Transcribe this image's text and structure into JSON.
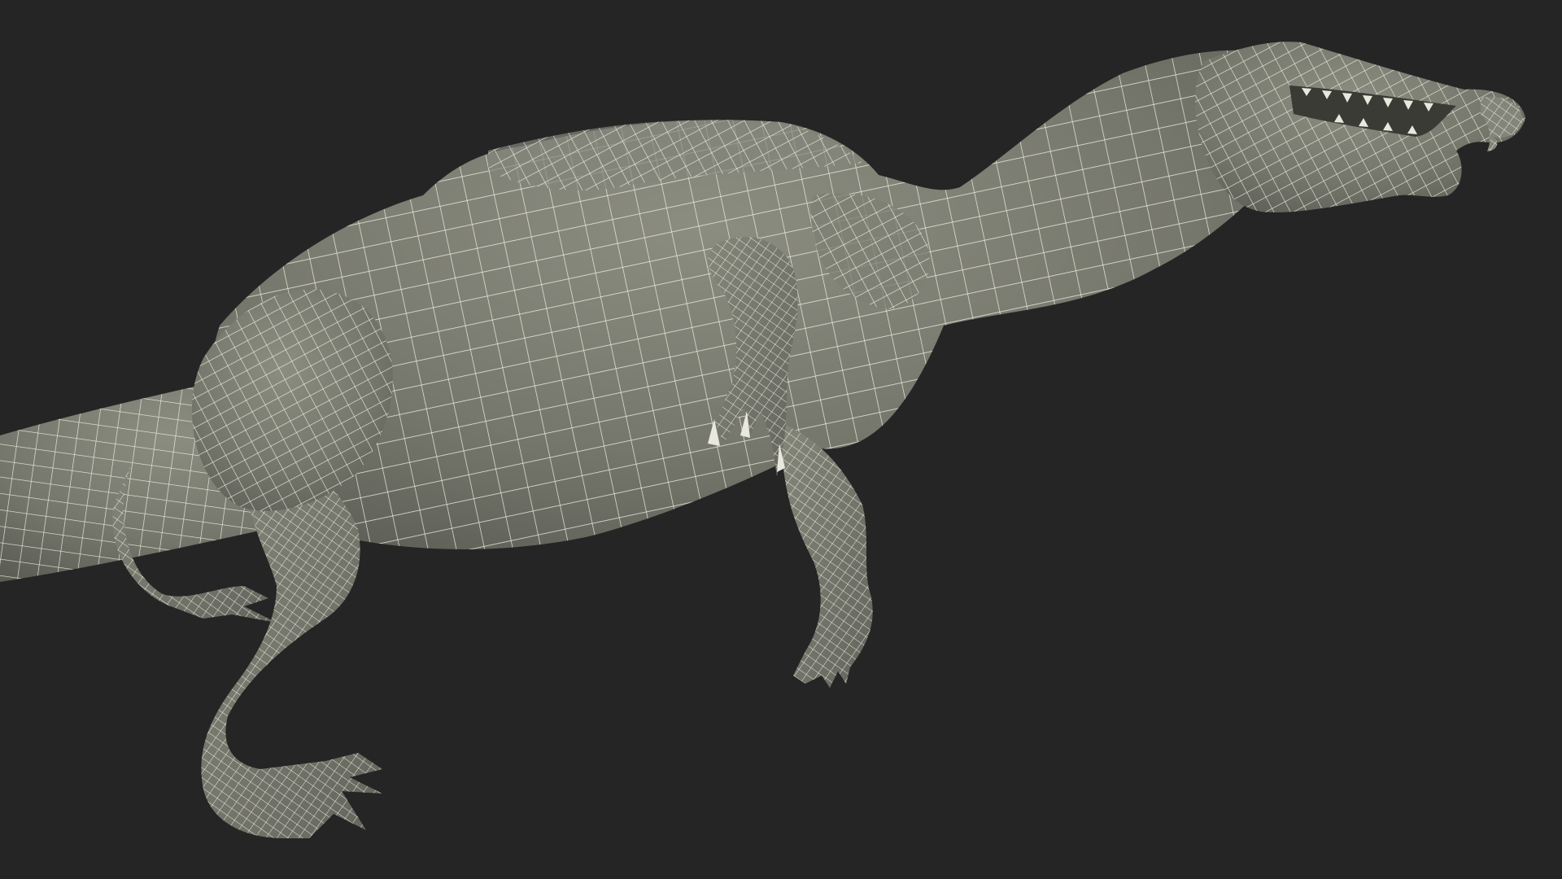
{
  "scene": {
    "subject": "wireframe-dinosaur-model",
    "render_style": "wireframe-over-shaded",
    "colors": {
      "background": "#252525",
      "surface": "#76776c",
      "surface_light": "#8e8f83",
      "surface_shadow": "#5f6058",
      "wire": "#f2f1e3",
      "teeth": "#e9e8dc",
      "mouth": "#3b3b36"
    },
    "parts": [
      "body",
      "tail",
      "neck",
      "head",
      "jaw",
      "teeth",
      "hind-leg-far",
      "hind-leg-near",
      "foot-far",
      "foot-near",
      "arm-near",
      "arm-far",
      "claws"
    ]
  }
}
